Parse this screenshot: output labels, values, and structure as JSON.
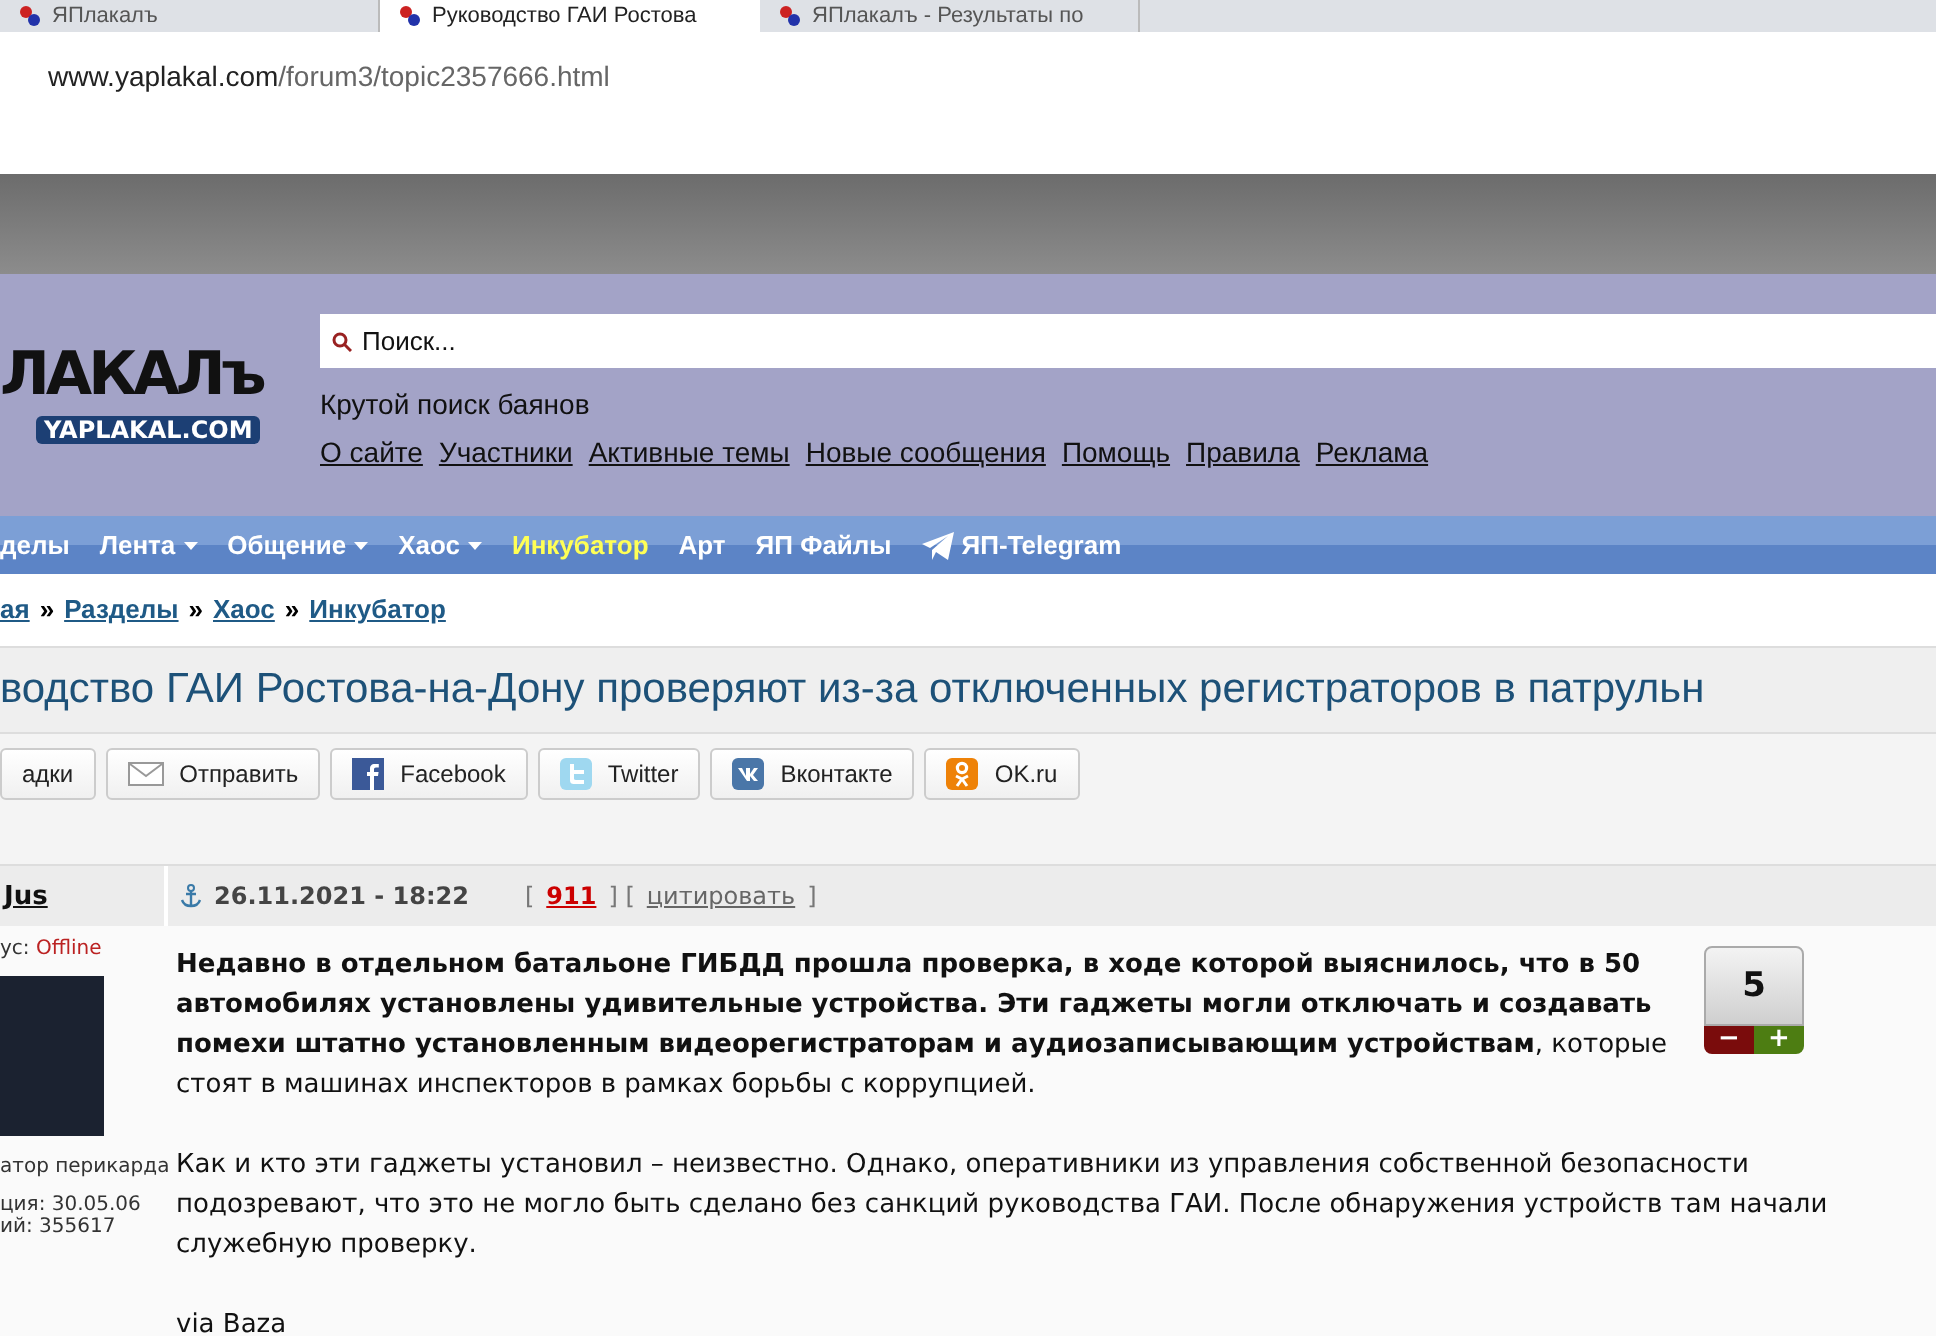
{
  "browser": {
    "tabs": [
      {
        "label": "ЯПлакалъ",
        "selected": false
      },
      {
        "label": "Руководство ГАИ Ростова",
        "selected": true
      },
      {
        "label": "ЯПлакалъ - Результаты по",
        "selected": false
      }
    ],
    "address": {
      "domain": "www.yaplakal.com",
      "path": "/forum3/topic2357666.html"
    }
  },
  "header": {
    "logo_text": "ЛАКАЛъ",
    "logo_sub": "YAPLAKAL.COM",
    "search": {
      "placeholder": "Поиск..."
    },
    "tagline": "Крутой поиск баянов",
    "links": [
      "О сайте",
      "Участники",
      "Активные темы",
      "Новые сообщения",
      "Помощь",
      "Правила",
      "Реклама"
    ]
  },
  "nav": [
    {
      "label": "делы",
      "kind": "plain"
    },
    {
      "label": "Лента",
      "kind": "dropdown"
    },
    {
      "label": "Общение",
      "kind": "dropdown"
    },
    {
      "label": "Хаос",
      "kind": "dropdown"
    },
    {
      "label": "Инкубатор",
      "kind": "highlight"
    },
    {
      "label": "Арт",
      "kind": "plain"
    },
    {
      "label": "ЯП Файлы",
      "kind": "plain"
    },
    {
      "label": "ЯП-Telegram",
      "kind": "telegram"
    }
  ],
  "breadcrumbs": {
    "separator": "»",
    "items": [
      "ая",
      "Разделы",
      "Хаос",
      "Инкубатор"
    ]
  },
  "title": "водство ГАИ Ростова-на-Дону проверяют из-за отключенных регистраторов в патрульн",
  "share_buttons": [
    {
      "label": "адки",
      "kind": "bookmark"
    },
    {
      "label": "Отправить",
      "kind": "mail"
    },
    {
      "label": "Facebook",
      "kind": "facebook"
    },
    {
      "label": "Twitter",
      "kind": "twitter"
    },
    {
      "label": "Вконтакте",
      "kind": "vk"
    },
    {
      "label": "OK.ru",
      "kind": "ok"
    }
  ],
  "post": {
    "author": "Jus",
    "date": "26.11.2021 - 18:22",
    "meta": [
      {
        "kind": "text",
        "text": "["
      },
      {
        "kind": "count",
        "text": "911"
      },
      {
        "kind": "text",
        "text": "] ["
      },
      {
        "kind": "link",
        "text": "цитировать"
      },
      {
        "kind": "text",
        "text": "]"
      }
    ],
    "user": {
      "status_label": "ус:",
      "status": "Offline",
      "rank": "атор перикарда",
      "registered": "ция: 30.05.06",
      "posts": "ий: 355617"
    },
    "paragraphs": [
      "**Недавно в отдельном батальоне ГИБДД прошла проверка, в ходе которой выяснилось, что в 50 автомобилях установлены удивительные устройства. Эти гаджеты могли отключать и создавать помехи штатно установленным видеорегистраторам и аудиозаписывающим устройствам**, которые стоят в машинах инспекторов в рамках борьбы с коррупцией.",
      "Как и кто эти гаджеты установил – неизвестно. Однако, оперативники из управления собственной безопасности подозревают, что это не могло быть сделано без санкций руководства ГАИ. После обнаружения устройств там начали служебную проверку.",
      "via Baza"
    ],
    "rating": {
      "value": "5",
      "minus": "−",
      "plus": "+"
    }
  }
}
